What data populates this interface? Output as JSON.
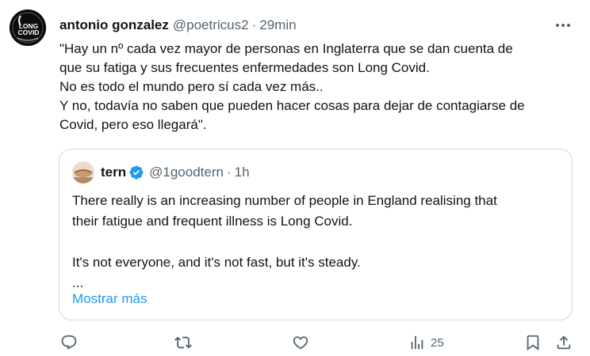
{
  "tweet": {
    "author_name": "antonio gonzalez",
    "handle": "@poetricus2",
    "separator": "·",
    "time": "29min",
    "avatar_logo": "LONG COVID AWARENESS",
    "avatar_logo_lines": [
      "LONG",
      "COVID"
    ],
    "text_lines": [
      "\"Hay un nº cada vez mayor de personas en Inglaterra que se dan cuenta de",
      "que su fatiga y sus frecuentes enfermedades son Long Covid.",
      "No es todo el mundo pero sí cada vez más..",
      "Y no, todavía no saben que pueden hacer cosas para dejar de contagiarse de",
      "Covid, pero eso llegará\"."
    ]
  },
  "quote": {
    "author_name": "tern",
    "verified": true,
    "handle": "@1goodtern",
    "separator": "·",
    "time": "1h",
    "text_lines": [
      "There really is an increasing number of people in England realising that",
      "their fatigue and frequent illness is Long Covid.",
      "",
      "It's not everyone, and it's not fast, but it's steady.",
      "..."
    ],
    "show_more": "Mostrar más"
  },
  "actions": {
    "reply_icon": "comment-icon",
    "retweet_icon": "retweet-icon",
    "like_icon": "heart-icon",
    "views_icon": "bar-chart-icon",
    "views_count": "25",
    "bookmark_icon": "bookmark-icon",
    "share_icon": "share-icon"
  },
  "colors": {
    "text": "#0f1419",
    "secondary": "#536471",
    "link": "#1d9bf0",
    "border": "#cfd9de",
    "verified": "#1d9bf0"
  }
}
